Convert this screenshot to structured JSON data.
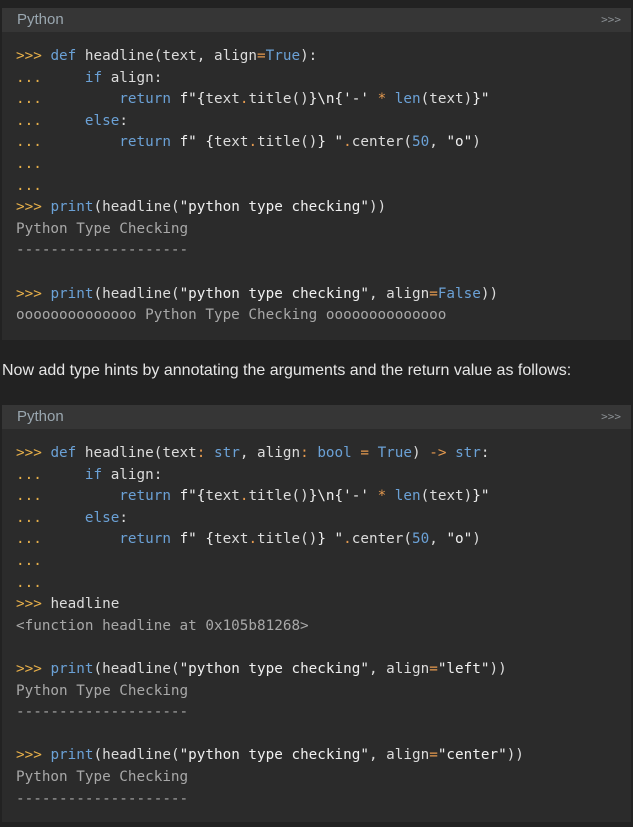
{
  "block1": {
    "language": "Python",
    "toggle": ">>>",
    "lines": [
      [
        {
          "c": "p",
          "t": ">>> "
        },
        {
          "c": "k",
          "t": "def "
        },
        {
          "c": "n",
          "t": "headline(text, align"
        },
        {
          "c": "o",
          "t": "="
        },
        {
          "c": "c",
          "t": "True"
        },
        {
          "c": "n",
          "t": "):"
        }
      ],
      [
        {
          "c": "p",
          "t": "...     "
        },
        {
          "c": "k",
          "t": "if "
        },
        {
          "c": "n",
          "t": "align:"
        }
      ],
      [
        {
          "c": "p",
          "t": "...         "
        },
        {
          "c": "k",
          "t": "return "
        },
        {
          "c": "s",
          "t": "f\"{"
        },
        {
          "c": "n",
          "t": "text"
        },
        {
          "c": "o",
          "t": "."
        },
        {
          "c": "n",
          "t": "title()"
        },
        {
          "c": "s",
          "t": "}\\n{'-' "
        },
        {
          "c": "o",
          "t": "* "
        },
        {
          "c": "k",
          "t": "len"
        },
        {
          "c": "n",
          "t": "(text)"
        },
        {
          "c": "s",
          "t": "}\""
        }
      ],
      [
        {
          "c": "p",
          "t": "...     "
        },
        {
          "c": "k",
          "t": "else"
        },
        {
          "c": "n",
          "t": ":"
        }
      ],
      [
        {
          "c": "p",
          "t": "...         "
        },
        {
          "c": "k",
          "t": "return "
        },
        {
          "c": "s",
          "t": "f\" {"
        },
        {
          "c": "n",
          "t": "text"
        },
        {
          "c": "o",
          "t": "."
        },
        {
          "c": "n",
          "t": "title()"
        },
        {
          "c": "s",
          "t": "} \""
        },
        {
          "c": "o",
          "t": "."
        },
        {
          "c": "n",
          "t": "center("
        },
        {
          "c": "m",
          "t": "50"
        },
        {
          "c": "n",
          "t": ", "
        },
        {
          "c": "s",
          "t": "\"o\""
        },
        {
          "c": "n",
          "t": ")"
        }
      ],
      [
        {
          "c": "p",
          "t": "..."
        }
      ],
      [
        {
          "c": "p",
          "t": "..."
        }
      ],
      [
        {
          "c": "p",
          "t": ">>> "
        },
        {
          "c": "k",
          "t": "print"
        },
        {
          "c": "n",
          "t": "(headline("
        },
        {
          "c": "s",
          "t": "\"python type checking\""
        },
        {
          "c": "n",
          "t": "))"
        }
      ],
      [
        {
          "c": "out",
          "t": "Python Type Checking"
        }
      ],
      [
        {
          "c": "out",
          "t": "--------------------"
        }
      ],
      [
        {
          "c": "n",
          "t": ""
        }
      ],
      [
        {
          "c": "p",
          "t": ">>> "
        },
        {
          "c": "k",
          "t": "print"
        },
        {
          "c": "n",
          "t": "(headline("
        },
        {
          "c": "s",
          "t": "\"python type checking\""
        },
        {
          "c": "n",
          "t": ", align"
        },
        {
          "c": "o",
          "t": "="
        },
        {
          "c": "c",
          "t": "False"
        },
        {
          "c": "n",
          "t": "))"
        }
      ],
      [
        {
          "c": "out",
          "t": "oooooooooooooo Python Type Checking oooooooooooooo"
        }
      ]
    ]
  },
  "prose": "Now add type hints by annotating the arguments and the return value as follows:",
  "block2": {
    "language": "Python",
    "toggle": ">>>",
    "lines": [
      [
        {
          "c": "p",
          "t": ">>> "
        },
        {
          "c": "k",
          "t": "def "
        },
        {
          "c": "n",
          "t": "headline(text"
        },
        {
          "c": "o",
          "t": ": "
        },
        {
          "c": "t",
          "t": "str"
        },
        {
          "c": "n",
          "t": ", align"
        },
        {
          "c": "o",
          "t": ": "
        },
        {
          "c": "t",
          "t": "bool "
        },
        {
          "c": "o",
          "t": "= "
        },
        {
          "c": "c",
          "t": "True"
        },
        {
          "c": "n",
          "t": ") "
        },
        {
          "c": "o",
          "t": "-> "
        },
        {
          "c": "t",
          "t": "str"
        },
        {
          "c": "n",
          "t": ":"
        }
      ],
      [
        {
          "c": "p",
          "t": "...     "
        },
        {
          "c": "k",
          "t": "if "
        },
        {
          "c": "n",
          "t": "align:"
        }
      ],
      [
        {
          "c": "p",
          "t": "...         "
        },
        {
          "c": "k",
          "t": "return "
        },
        {
          "c": "s",
          "t": "f\"{"
        },
        {
          "c": "n",
          "t": "text"
        },
        {
          "c": "o",
          "t": "."
        },
        {
          "c": "n",
          "t": "title()"
        },
        {
          "c": "s",
          "t": "}\\n{'-' "
        },
        {
          "c": "o",
          "t": "* "
        },
        {
          "c": "k",
          "t": "len"
        },
        {
          "c": "n",
          "t": "(text)"
        },
        {
          "c": "s",
          "t": "}\""
        }
      ],
      [
        {
          "c": "p",
          "t": "...     "
        },
        {
          "c": "k",
          "t": "else"
        },
        {
          "c": "n",
          "t": ":"
        }
      ],
      [
        {
          "c": "p",
          "t": "...         "
        },
        {
          "c": "k",
          "t": "return "
        },
        {
          "c": "s",
          "t": "f\" {"
        },
        {
          "c": "n",
          "t": "text"
        },
        {
          "c": "o",
          "t": "."
        },
        {
          "c": "n",
          "t": "title()"
        },
        {
          "c": "s",
          "t": "} \""
        },
        {
          "c": "o",
          "t": "."
        },
        {
          "c": "n",
          "t": "center("
        },
        {
          "c": "m",
          "t": "50"
        },
        {
          "c": "n",
          "t": ", "
        },
        {
          "c": "s",
          "t": "\"o\""
        },
        {
          "c": "n",
          "t": ")"
        }
      ],
      [
        {
          "c": "p",
          "t": "..."
        }
      ],
      [
        {
          "c": "p",
          "t": "..."
        }
      ],
      [
        {
          "c": "p",
          "t": ">>> "
        },
        {
          "c": "n",
          "t": "headline"
        }
      ],
      [
        {
          "c": "out",
          "t": "<function headline at 0x105b81268>"
        }
      ],
      [
        {
          "c": "n",
          "t": ""
        }
      ],
      [
        {
          "c": "p",
          "t": ">>> "
        },
        {
          "c": "k",
          "t": "print"
        },
        {
          "c": "n",
          "t": "(headline("
        },
        {
          "c": "s",
          "t": "\"python type checking\""
        },
        {
          "c": "n",
          "t": ", align"
        },
        {
          "c": "o",
          "t": "="
        },
        {
          "c": "s",
          "t": "\"left\""
        },
        {
          "c": "n",
          "t": "))"
        }
      ],
      [
        {
          "c": "out",
          "t": "Python Type Checking"
        }
      ],
      [
        {
          "c": "out",
          "t": "--------------------"
        }
      ],
      [
        {
          "c": "n",
          "t": ""
        }
      ],
      [
        {
          "c": "p",
          "t": ">>> "
        },
        {
          "c": "k",
          "t": "print"
        },
        {
          "c": "n",
          "t": "(headline("
        },
        {
          "c": "s",
          "t": "\"python type checking\""
        },
        {
          "c": "n",
          "t": ", align"
        },
        {
          "c": "o",
          "t": "="
        },
        {
          "c": "s",
          "t": "\"center\""
        },
        {
          "c": "n",
          "t": "))"
        }
      ],
      [
        {
          "c": "out",
          "t": "Python Type Checking"
        }
      ],
      [
        {
          "c": "out",
          "t": "--------------------"
        }
      ]
    ]
  }
}
